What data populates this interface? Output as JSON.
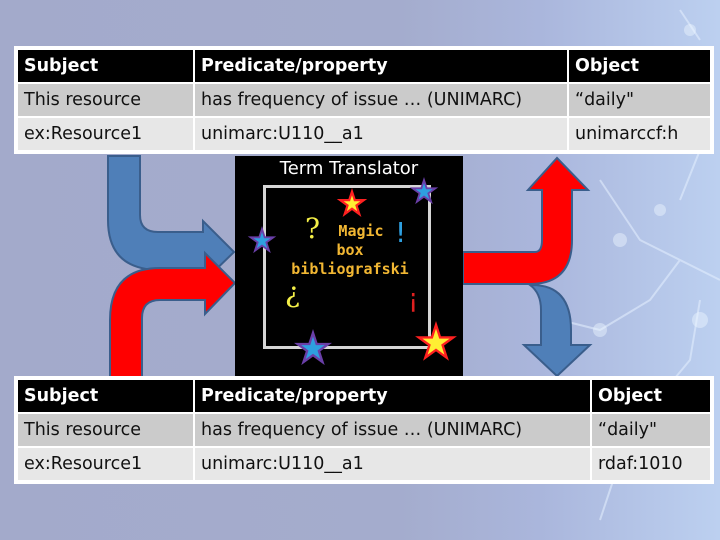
{
  "colors": {
    "blue_arrow": "#4f7fb8",
    "blue_arrow_stroke": "#3a5e8c",
    "red_arrow": "#ff0000",
    "header_bg": "#000000",
    "row_odd_bg": "#cbcbcb",
    "row_even_bg": "#e7e7e7",
    "magic_text": "#f2b733"
  },
  "table_top": {
    "headers": [
      "Subject",
      "Predicate/property",
      "Object"
    ],
    "rows": [
      [
        "This resource",
        "has frequency of issue … (UNIMARC)",
        "“daily\""
      ],
      [
        "ex:Resource1",
        "unimarc:U110__a1",
        "unimarccf:h"
      ]
    ]
  },
  "table_bottom": {
    "headers": [
      "Subject",
      "Predicate/property",
      "Object"
    ],
    "rows": [
      [
        "This resource",
        "has frequency of issue … (UNIMARC)",
        "“daily\""
      ],
      [
        "ex:Resource1",
        "unimarc:U110__a1",
        "rdaf:1010"
      ]
    ]
  },
  "magic_box": {
    "title": "Term Translator",
    "line1": "Magic",
    "line2": "box",
    "line3": "bibliografski",
    "question_mark": "?",
    "inverted_question_mark": "¿",
    "exclamation_mark": "!",
    "inverted_exclamation_mark": "¡"
  },
  "icons": {
    "left_blue_arrow": "bent-arrow-right-icon",
    "left_red_arrow": "bent-arrow-right-icon",
    "right_red_arrow": "bent-arrow-up-icon",
    "right_blue_arrow": "bent-arrow-down-icon",
    "stars": "star-icon"
  }
}
